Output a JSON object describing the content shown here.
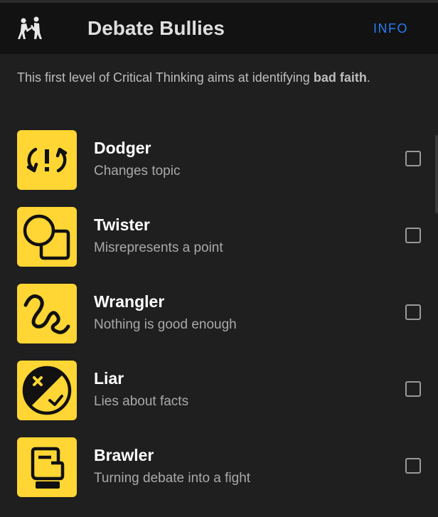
{
  "header": {
    "title": "Debate Bullies",
    "info_label": "INFO",
    "logo_icon": "fighting-figures-icon"
  },
  "intro": {
    "text_before": "This first level of Critical Thinking aims at identifying ",
    "text_bold": "bad faith",
    "text_after": "."
  },
  "items": [
    {
      "name": "Dodger",
      "description": "Changes topic",
      "icon": "dodge-arrows-icon",
      "checked": false
    },
    {
      "name": "Twister",
      "description": "Misrepresents a point",
      "icon": "circle-square-icon",
      "checked": false
    },
    {
      "name": "Wrangler",
      "description": "Nothing is good enough",
      "icon": "squiggle-icon",
      "checked": false
    },
    {
      "name": "Liar",
      "description": "Lies about facts",
      "icon": "cross-check-circle-icon",
      "checked": false
    },
    {
      "name": "Brawler",
      "description": "Turning debate into a fight",
      "icon": "boxing-glove-icon",
      "checked": false
    }
  ],
  "colors": {
    "background": "#1f1f1f",
    "header": "#121212",
    "accent": "#2b7bf2",
    "tile": "#ffd633"
  }
}
